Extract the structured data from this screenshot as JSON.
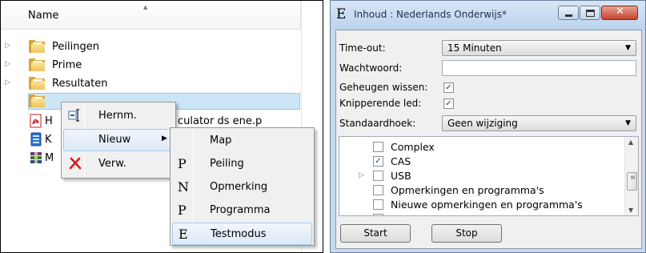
{
  "explorer": {
    "column_header": "Name",
    "tree": [
      {
        "label": "Peilingen"
      },
      {
        "label": "Prime"
      },
      {
        "label": "Resultaten"
      }
    ],
    "files": [
      {
        "label_visible": "H",
        "label_tail": "culator ds ene.p"
      },
      {
        "label_visible": "K"
      },
      {
        "label_visible": "M"
      }
    ]
  },
  "context_menu": {
    "items": [
      {
        "label": "Hernm.",
        "icon": "rename-icon"
      },
      {
        "label": "Nieuw",
        "icon": "",
        "submenu_arrow": "▶"
      },
      {
        "label": "Verw.",
        "icon": "delete-icon"
      }
    ]
  },
  "submenu": {
    "items": [
      {
        "letter": "",
        "label": "Map"
      },
      {
        "letter": "P",
        "label": "Peiling"
      },
      {
        "letter": "N",
        "label": "Opmerking"
      },
      {
        "letter": "P",
        "label": "Programma"
      },
      {
        "letter": "E",
        "label": "Testmodus"
      }
    ],
    "highlighted": "Testmodus"
  },
  "dialog": {
    "icon_letter": "E",
    "title": "Inhoud : Nederlands Onderwijs*",
    "fields": {
      "timeout_label": "Time-out:",
      "timeout_value": "15 Minuten",
      "password_label": "Wachtwoord:",
      "password_value": "",
      "memory_label": "Geheugen wissen:",
      "memory_checked": true,
      "led_label": "Knipperende led:",
      "led_checked": true,
      "angle_label": "Standaardhoek:",
      "angle_value": "Geen wijziging"
    },
    "options": [
      {
        "label": "Complex",
        "checked": false,
        "expandable": false
      },
      {
        "label": "CAS",
        "checked": true,
        "expandable": false
      },
      {
        "label": "USB",
        "checked": false,
        "expandable": true
      },
      {
        "label": "Opmerkingen en programma's",
        "checked": false,
        "expandable": false
      },
      {
        "label": "Nieuwe opmerkingen en programma's",
        "checked": false,
        "expandable": false
      }
    ],
    "check_glyph": "✓",
    "buttons": {
      "start": "Start",
      "stop": "Stop"
    }
  },
  "colors": {
    "selection": "#cde6f7",
    "menu_highlight": "#dbe9f7",
    "dialog_frame": "#c6d9ef",
    "close_button": "#c6442b"
  }
}
